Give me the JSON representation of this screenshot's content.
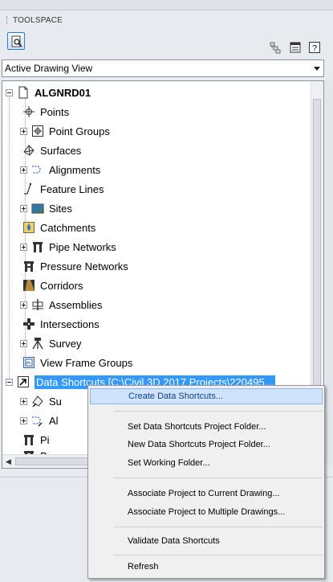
{
  "panel": {
    "title": "TOOLSPACE"
  },
  "toolbar": {
    "buttons": [
      {
        "name": "prospector-tab",
        "icon": "magnifier-document-icon"
      },
      {
        "name": "item-view-toggle",
        "icon": "item-view-icon"
      },
      {
        "name": "panel-options",
        "icon": "panel-options-icon"
      },
      {
        "name": "help",
        "icon": "help-icon",
        "glyph": "?"
      }
    ]
  },
  "view_select": {
    "value": "Active Drawing View"
  },
  "tree": {
    "root": {
      "label": "ALGNRD01"
    },
    "items": [
      {
        "label": "Points",
        "expandable": false
      },
      {
        "label": "Point Groups",
        "expandable": true
      },
      {
        "label": "Surfaces",
        "expandable": false
      },
      {
        "label": "Alignments",
        "expandable": true
      },
      {
        "label": "Feature Lines",
        "expandable": false
      },
      {
        "label": "Sites",
        "expandable": true
      },
      {
        "label": "Catchments",
        "expandable": false
      },
      {
        "label": "Pipe Networks",
        "expandable": true
      },
      {
        "label": "Pressure Networks",
        "expandable": false
      },
      {
        "label": "Corridors",
        "expandable": false
      },
      {
        "label": "Assemblies",
        "expandable": true
      },
      {
        "label": "Intersections",
        "expandable": false
      },
      {
        "label": "Survey",
        "expandable": true
      },
      {
        "label": "View Frame Groups",
        "expandable": false
      }
    ],
    "shortcuts_root": {
      "label": "Data Shortcuts [C:\\Civil 3D 2017 Projects\\220495..."
    },
    "shortcuts_children": [
      {
        "label": "Su",
        "expandable": true
      },
      {
        "label": "Al",
        "expandable": true
      },
      {
        "label": "Pi",
        "expandable": false
      },
      {
        "label": "Pr",
        "expandable": false
      }
    ]
  },
  "context_menu": {
    "items": [
      {
        "label": "Create Data Shortcuts...",
        "highlighted": true
      },
      {
        "label": "Set Data Shortcuts Project Folder..."
      },
      {
        "label": "New Data Shortcuts Project Folder..."
      },
      {
        "label": "Set Working Folder..."
      },
      {
        "label": "Associate Project to Current Drawing..."
      },
      {
        "label": "Associate Project to Multiple Drawings..."
      },
      {
        "label": "Validate Data Shortcuts"
      },
      {
        "label": "Refresh"
      }
    ]
  },
  "colors": {
    "selection": "#3399ff",
    "menu_highlight": "#cfe3fb"
  }
}
